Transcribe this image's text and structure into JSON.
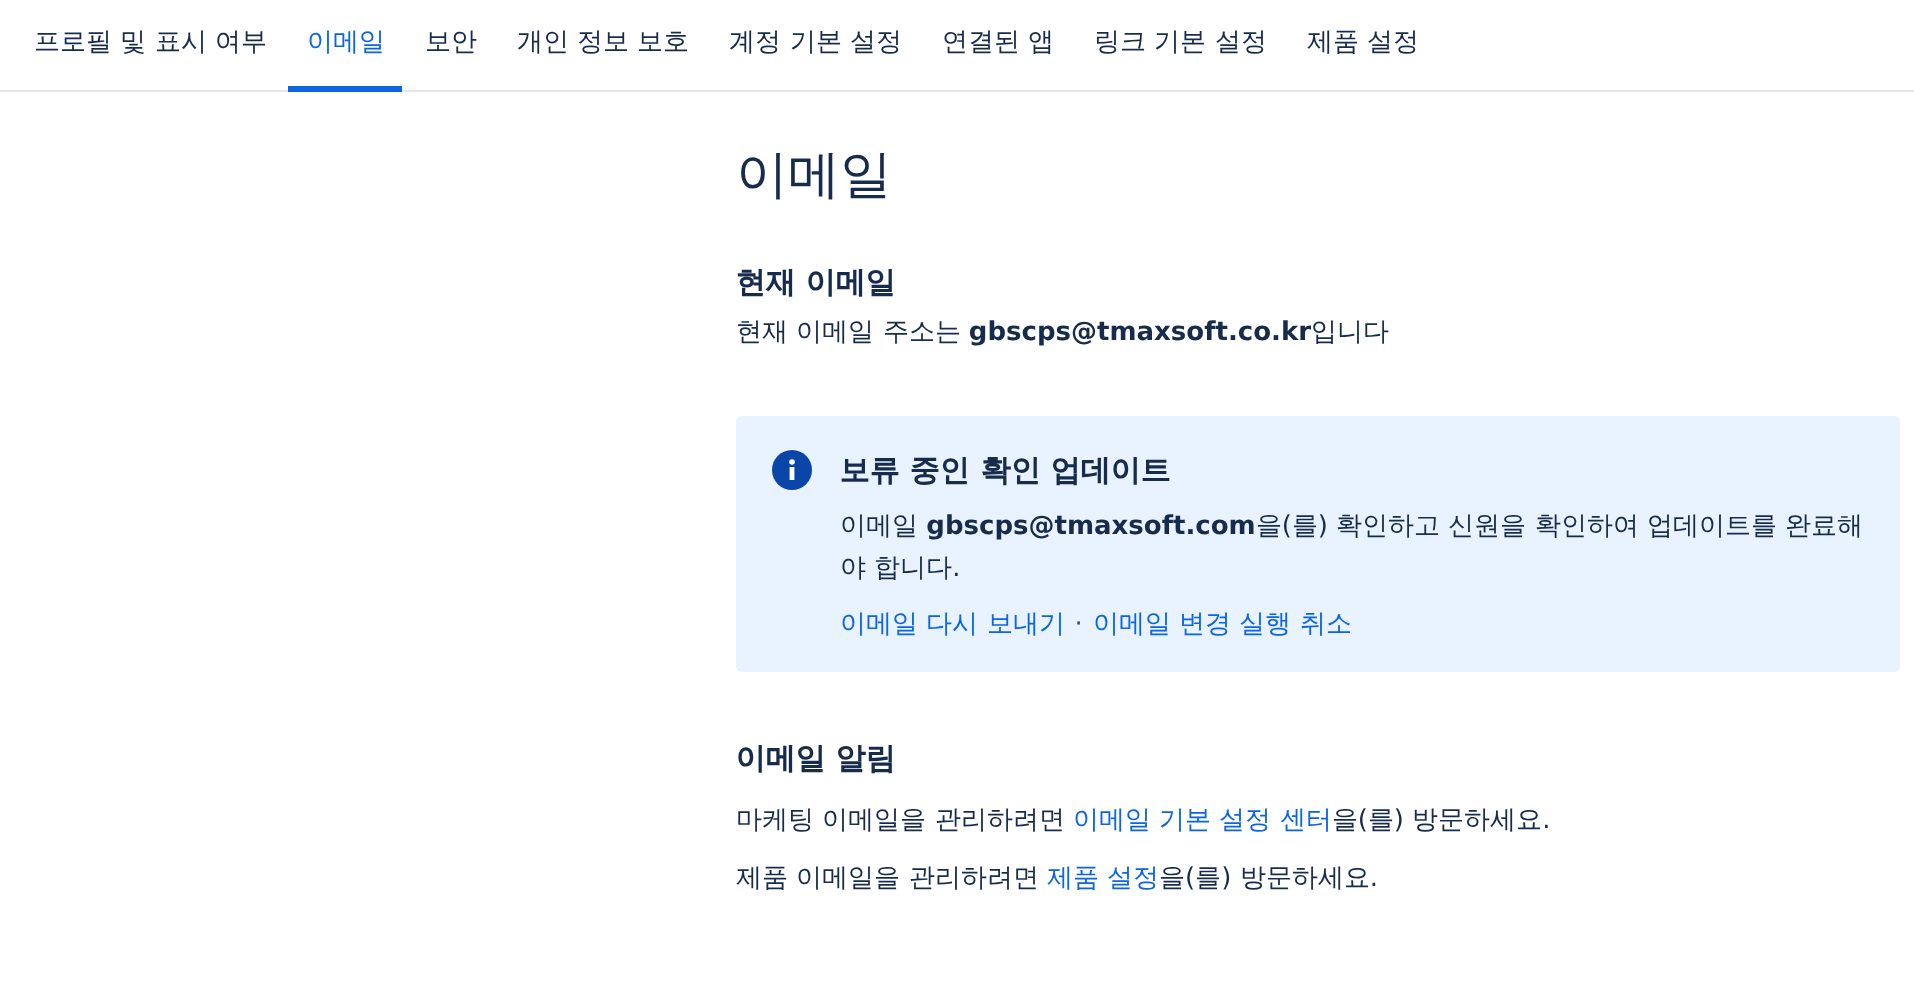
{
  "tabs": [
    {
      "label": "프로필 및 표시 여부",
      "selected": false
    },
    {
      "label": "이메일",
      "selected": true
    },
    {
      "label": "보안",
      "selected": false
    },
    {
      "label": "개인 정보 보호",
      "selected": false
    },
    {
      "label": "계정 기본 설정",
      "selected": false
    },
    {
      "label": "연결된 앱",
      "selected": false
    },
    {
      "label": "링크 기본 설정",
      "selected": false
    },
    {
      "label": "제품 설정",
      "selected": false
    }
  ],
  "page_title": "이메일",
  "current_email": {
    "heading": "현재 이메일",
    "text": "현재 이메일 주소는 **gbscps@tmaxsoft.co.kr**입니다"
  },
  "notice": {
    "title": "보류 중인 확인 업데이트",
    "text": "이메일 **gbscps@tmaxsoft.com**을(를) 확인하고 신원을 확인하여 업데이트를 완료해야 합니다.",
    "links": [
      "이메일 다시 보내기",
      "이메일 변경 실행 취소"
    ],
    "separator": "·"
  },
  "notifications": {
    "heading": "이메일 알림",
    "sentences": [
      [
        {
          "kind": "text",
          "text": "마케팅 이메일을 관리하려면 "
        },
        {
          "kind": "link",
          "text": "이메일 기본 설정 센터"
        },
        {
          "kind": "text",
          "text": "을(를) 방문하세요."
        }
      ],
      [
        {
          "kind": "text",
          "text": "제품 이메일을 관리하려면 "
        },
        {
          "kind": "link",
          "text": "제품 설정"
        },
        {
          "kind": "text",
          "text": "을(를) 방문하세요."
        }
      ]
    ]
  }
}
